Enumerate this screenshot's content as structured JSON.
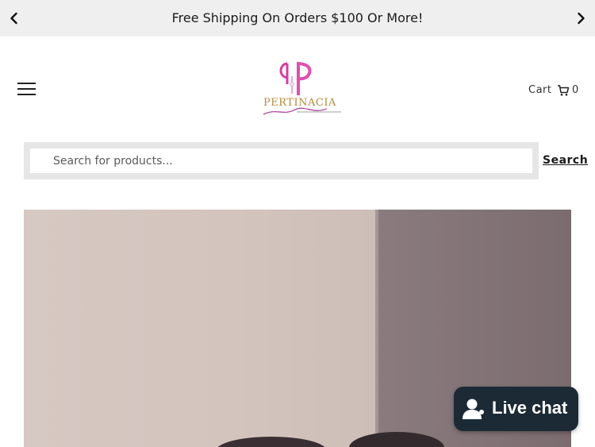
{
  "announcement": {
    "text": "Free Shipping On Orders $100 Or More!",
    "prev_icon": "chevron-left-icon",
    "next_icon": "chevron-right-icon"
  },
  "header": {
    "menu_icon": "hamburger-menu-icon",
    "logo": {
      "brand": "PERTINACIA",
      "monogram": "PP"
    },
    "cart": {
      "label": "Cart",
      "icon": "cart-icon",
      "count": "0"
    }
  },
  "search": {
    "placeholder": "Search for products...",
    "button_label": "Search"
  },
  "livechat": {
    "label": "Live chat",
    "icon": "chat-person-icon"
  },
  "colors": {
    "announcement_bg": "#efefef",
    "search_frame": "#e6e6e6",
    "chat_bg": "#1b2a35",
    "logo_pink": "#d63ea0",
    "logo_gold": "#b58a3c"
  }
}
